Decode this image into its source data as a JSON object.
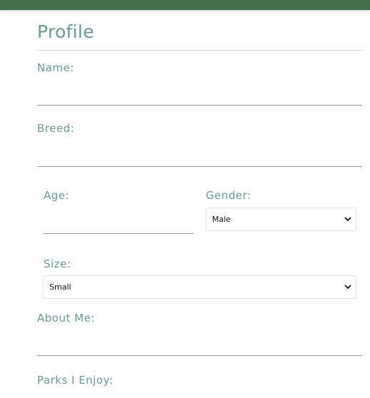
{
  "profile": {
    "title": "Profile",
    "name_label": "Name:",
    "breed_label": "Breed:",
    "age_label": "Age:",
    "gender_label": "Gender:",
    "gender_value": "Male",
    "size_label": "Size:",
    "size_value": "Small",
    "about_label": "About Me:",
    "parks_label": "Parks I Enjoy:"
  },
  "colors": {
    "header_bar": "#436f4d",
    "label_text": "#6b9a94",
    "field_line": "#9a9a9a"
  },
  "icons": {
    "select_arrow": "chevron-down-icon"
  }
}
